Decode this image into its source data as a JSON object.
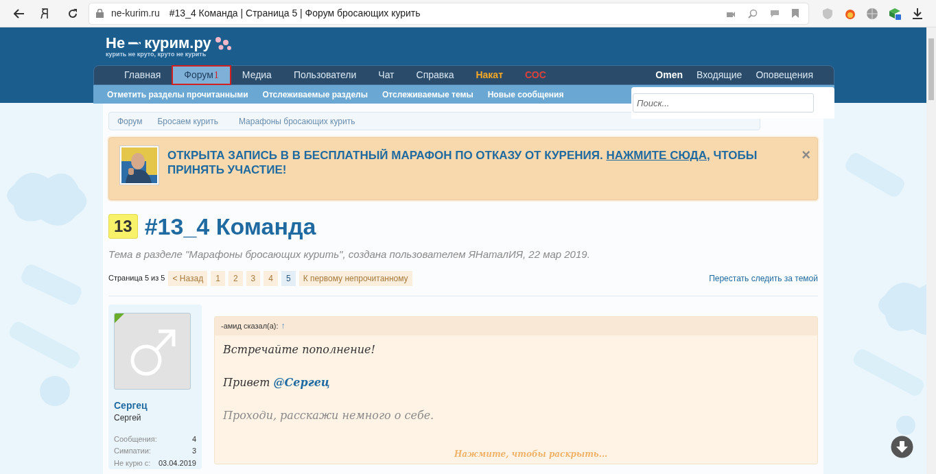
{
  "browser": {
    "domain": "ne-kurim.ru",
    "title": "#13_4 Команда | Страница 5 | Форум бросающих курить"
  },
  "logo": {
    "name": "Не",
    "name2": "курим.ру",
    "tagline": "курить не круто, круто не курить"
  },
  "nav": {
    "tabs": [
      {
        "label": "Главная",
        "selected": false
      },
      {
        "label": "Форум",
        "selected": true,
        "badge": "1"
      },
      {
        "label": "Медиа",
        "selected": false
      },
      {
        "label": "Пользователи",
        "selected": false
      },
      {
        "label": "Чат",
        "selected": false
      },
      {
        "label": "Справка",
        "selected": false
      },
      {
        "label": "Накат",
        "selected": false,
        "kind": "highlight"
      },
      {
        "label": "СОС",
        "selected": false,
        "kind": "alert"
      }
    ],
    "user_links": [
      {
        "label": "Omen",
        "kind": "user"
      },
      {
        "label": "Входящие",
        "kind": "link"
      },
      {
        "label": "Оповещения",
        "kind": "link"
      }
    ],
    "sub_links": [
      "Отметить разделы прочитанными",
      "Отслеживаемые разделы",
      "Отслеживаемые темы",
      "Новые сообщения"
    ],
    "search": {
      "placeholder": "Поиск..."
    }
  },
  "breadcrumbs": [
    "Форум",
    "Бросаем курить",
    "Марафоны бросающих курить"
  ],
  "notice": {
    "text_before": "ОТКРЫТА ЗАПИСЬ В В БЕСПЛАТНЫЙ МАРАФОН ПО ОТКАЗУ ОТ КУРЕНИЯ.",
    "link": "НАЖМИТЕ СЮДА",
    "text_after": ", ЧТОБЫ ПРИНЯТЬ УЧАСТИЕ!",
    "close": "×"
  },
  "thread": {
    "prefix": "13",
    "title": "#13_4 Команда",
    "description": "Тема в разделе \"Марафоны бросающих курить\", создана пользователем ЯНаталИЯ, 22 мар 2019."
  },
  "pagination": {
    "label": "Страница 5 из 5",
    "prev": "< Назад",
    "pages": [
      {
        "label": "1",
        "selected": false
      },
      {
        "label": "2",
        "selected": false
      },
      {
        "label": "3",
        "selected": false
      },
      {
        "label": "4",
        "selected": false
      },
      {
        "label": "5",
        "selected": true
      }
    ],
    "unread": "К первому непрочитанному",
    "unwatch": "Перестать следить за темой"
  },
  "post": {
    "user": {
      "name": "Сергец",
      "title": "Сергей",
      "online": true,
      "stats": [
        {
          "label": "Сообщения:",
          "value": "4"
        },
        {
          "label": "Симпатии:",
          "value": "3"
        },
        {
          "label": "Не курю с:",
          "value": "03.04.2019"
        }
      ]
    },
    "quote": {
      "author": "-амид сказал(а):",
      "arrow": "↑",
      "line1": "Встречайте пополнение!",
      "greeting": "Привет",
      "mention": "@Сергец",
      "line3": "Проходи, расскажи немного о себе.",
      "expand": "Нажмите, чтобы раскрыть..."
    }
  }
}
